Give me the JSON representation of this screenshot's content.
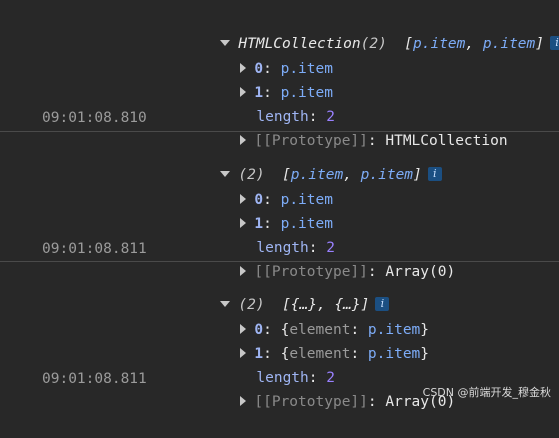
{
  "entries": [
    {
      "timestamp": "09:01:08.810",
      "header": {
        "name": "HTMLCollection",
        "count": "(2)",
        "preview_open": "[",
        "item1": "p.item",
        "sep": ", ",
        "item2": "p.item",
        "preview_close": "]"
      },
      "rows": [
        {
          "key": "0",
          "colon": ": ",
          "value": "p.item"
        },
        {
          "key": "1",
          "colon": ": ",
          "value": "p.item"
        }
      ],
      "length_key": "length",
      "length_colon": ": ",
      "length_value": "2",
      "prototype_label": "[[Prototype]]",
      "prototype_colon": ": ",
      "prototype_value": "HTMLCollection"
    },
    {
      "timestamp": "09:01:08.811",
      "header": {
        "count": "(2)",
        "preview_open": "[",
        "item1": "p.item",
        "sep": ", ",
        "item2": "p.item",
        "preview_close": "]"
      },
      "rows": [
        {
          "key": "0",
          "colon": ": ",
          "value": "p.item"
        },
        {
          "key": "1",
          "colon": ": ",
          "value": "p.item"
        }
      ],
      "length_key": "length",
      "length_colon": ": ",
      "length_value": "2",
      "prototype_label": "[[Prototype]]",
      "prototype_colon": ": ",
      "prototype_value": "Array(0)"
    },
    {
      "timestamp": "09:01:08.811",
      "header": {
        "count": "(2)",
        "preview": "[{…}, {…}]"
      },
      "rows": [
        {
          "key": "0",
          "colon": ": ",
          "open": "{",
          "inner_key": "element",
          "inner_colon": ": ",
          "value": "p.item",
          "close": "}"
        },
        {
          "key": "1",
          "colon": ": ",
          "open": "{",
          "inner_key": "element",
          "inner_colon": ": ",
          "value": "p.item",
          "close": "}"
        }
      ],
      "length_key": "length",
      "length_colon": ": ",
      "length_value": "2",
      "prototype_label": "[[Prototype]]",
      "prototype_colon": ": ",
      "prototype_value": "Array(0)"
    }
  ],
  "info_icon_glyph": "i",
  "watermark": "CSDN @前端开发_穆金秋"
}
